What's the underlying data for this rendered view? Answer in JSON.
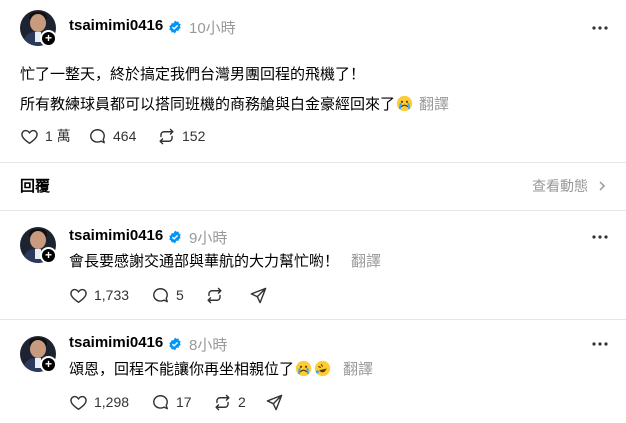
{
  "main_post": {
    "username": "tsaimimi0416",
    "time": "10小時",
    "line1": "忙了一整天，終於搞定我們台灣男團回程的飛機了！",
    "line2": "所有教練球員都可以搭同班機的商務艙與白金豪經回來了",
    "translate": "翻譯",
    "likes": "1 萬",
    "comments": "464",
    "reposts": "152"
  },
  "replies_header": {
    "title": "回覆",
    "view_activity": "查看動態"
  },
  "reply1": {
    "username": "tsaimimi0416",
    "time": "9小時",
    "text": "會長要感謝交通部與華航的大力幫忙喲！",
    "translate": "翻譯",
    "likes": "1,733",
    "comments": "5"
  },
  "reply2": {
    "username": "tsaimimi0416",
    "time": "8小時",
    "text": "頌恩，回程不能讓你再坐相親位了",
    "translate": "翻譯",
    "likes": "1,298",
    "comments": "17",
    "reposts": "2"
  },
  "icons": {
    "verified": "verified-badge-icon",
    "more": "more-options-icon",
    "like": "heart-icon",
    "comment": "comment-icon",
    "repost": "repost-icon",
    "share": "send-icon"
  },
  "colors": {
    "verified": "#0095f6",
    "muted": "#999999"
  }
}
